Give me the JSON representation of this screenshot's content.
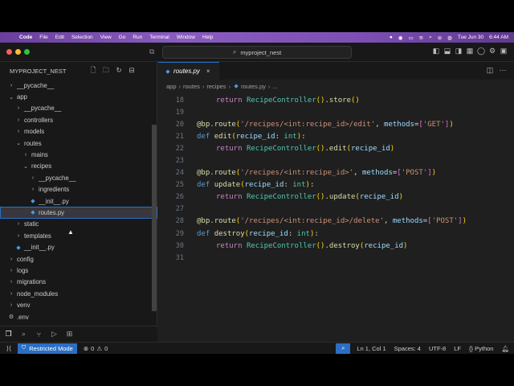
{
  "menubar": {
    "app_name": "Code",
    "items": [
      "File",
      "Edit",
      "Selection",
      "View",
      "Go",
      "Run",
      "Terminal",
      "Window",
      "Help"
    ],
    "date": "Tue Jun 30",
    "time": "6:44 AM"
  },
  "titlebar": {
    "search_text": "myproject_nest"
  },
  "sidebar": {
    "header": "MYPROJECT_NEST",
    "tree": [
      {
        "label": "__pycache__",
        "depth": 0,
        "kind": "folder",
        "open": false
      },
      {
        "label": "app",
        "depth": 0,
        "kind": "folder",
        "open": true
      },
      {
        "label": "__pycache__",
        "depth": 1,
        "kind": "folder",
        "open": false
      },
      {
        "label": "controllers",
        "depth": 1,
        "kind": "folder",
        "open": false
      },
      {
        "label": "models",
        "depth": 1,
        "kind": "folder",
        "open": false
      },
      {
        "label": "routes",
        "depth": 1,
        "kind": "folder",
        "open": true
      },
      {
        "label": "mains",
        "depth": 2,
        "kind": "folder",
        "open": false
      },
      {
        "label": "recipes",
        "depth": 2,
        "kind": "folder",
        "open": true
      },
      {
        "label": "__pycache__",
        "depth": 3,
        "kind": "folder",
        "open": false
      },
      {
        "label": "ingredients",
        "depth": 3,
        "kind": "folder",
        "open": false
      },
      {
        "label": "__init__.py",
        "depth": 3,
        "kind": "file",
        "open": false
      },
      {
        "label": "routes.py",
        "depth": 3,
        "kind": "file",
        "open": false,
        "selected": true
      },
      {
        "label": "static",
        "depth": 1,
        "kind": "folder",
        "open": false
      },
      {
        "label": "templates",
        "depth": 1,
        "kind": "folder",
        "open": false
      },
      {
        "label": "__init__.py",
        "depth": 1,
        "kind": "file",
        "open": false
      },
      {
        "label": "config",
        "depth": 0,
        "kind": "folder",
        "open": false
      },
      {
        "label": "logs",
        "depth": 0,
        "kind": "folder",
        "open": false
      },
      {
        "label": "migrations",
        "depth": 0,
        "kind": "folder",
        "open": false
      },
      {
        "label": "node_modules",
        "depth": 0,
        "kind": "folder",
        "open": false
      },
      {
        "label": "venv",
        "depth": 0,
        "kind": "folder",
        "open": false
      },
      {
        "label": ".env",
        "depth": 0,
        "kind": "gear",
        "open": false
      }
    ]
  },
  "editor": {
    "tab_label": "routes.py",
    "breadcrumb": [
      "app",
      "routes",
      "recipes",
      "routes.py",
      "..."
    ],
    "lines": [
      {
        "n": "18",
        "text": "return RecipeController().store()"
      },
      {
        "n": "19",
        "text": ""
      },
      {
        "n": "20",
        "text": "@bp.route('/recipes/<int:recipe_id>/edit', methods=['GET'])"
      },
      {
        "n": "21",
        "text": "def edit(recipe_id: int):"
      },
      {
        "n": "22",
        "text": "return RecipeController().edit(recipe_id)"
      },
      {
        "n": "23",
        "text": ""
      },
      {
        "n": "24",
        "text": "@bp.route('/recipes/<int:recipe_id>', methods=['POST'])"
      },
      {
        "n": "25",
        "text": "def update(recipe_id: int):"
      },
      {
        "n": "26",
        "text": "return RecipeController().update(recipe_id)"
      },
      {
        "n": "27",
        "text": ""
      },
      {
        "n": "28",
        "text": "@bp.route('/recipes/<int:recipe_id>/delete', methods=['POST'])"
      },
      {
        "n": "29",
        "text": "def destroy(recipe_id: int):"
      },
      {
        "n": "30",
        "text": "return RecipeController().destroy(recipe_id)"
      },
      {
        "n": "31",
        "text": ""
      }
    ]
  },
  "statusbar": {
    "restricted_mode": "Restricted Mode",
    "errors": "0",
    "warnings": "0",
    "position": "Ln 1, Col 1",
    "spaces": "Spaces: 4",
    "encoding": "UTF-8",
    "eol": "LF",
    "language": "Python"
  },
  "colors": {
    "accent": "#2a6fc4",
    "menubar": "#7d4fb5",
    "editor_bg": "#1f1f1f",
    "sidebar_bg": "#181818"
  }
}
